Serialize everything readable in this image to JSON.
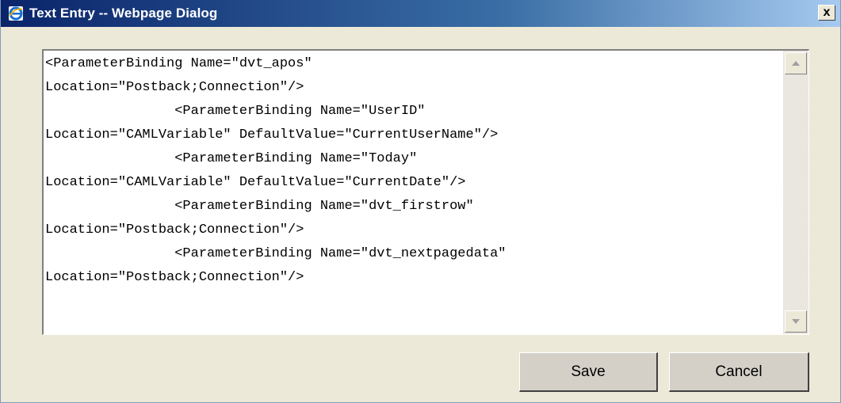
{
  "window": {
    "title": "Text Entry -- Webpage Dialog",
    "icon": "internet-explorer-icon",
    "close_label": "x"
  },
  "editor": {
    "lines": [
      "<ParameterBinding Name=\"dvt_apos\"",
      "Location=\"Postback;Connection\"/>",
      "                <ParameterBinding Name=\"UserID\"",
      "Location=\"CAMLVariable\" DefaultValue=\"CurrentUserName\"/>",
      "                <ParameterBinding Name=\"Today\"",
      "Location=\"CAMLVariable\" DefaultValue=\"CurrentDate\"/>",
      "                <ParameterBinding Name=\"dvt_firstrow\"",
      "Location=\"Postback;Connection\"/>",
      "                <ParameterBinding Name=\"dvt_nextpagedata\"",
      "Location=\"Postback;Connection\"/>"
    ]
  },
  "buttons": {
    "save_label": "Save",
    "cancel_label": "Cancel"
  },
  "colors": {
    "titlebar_start": "#0a246a",
    "titlebar_end": "#a6caf0",
    "dialog_background": "#ece9d8"
  }
}
